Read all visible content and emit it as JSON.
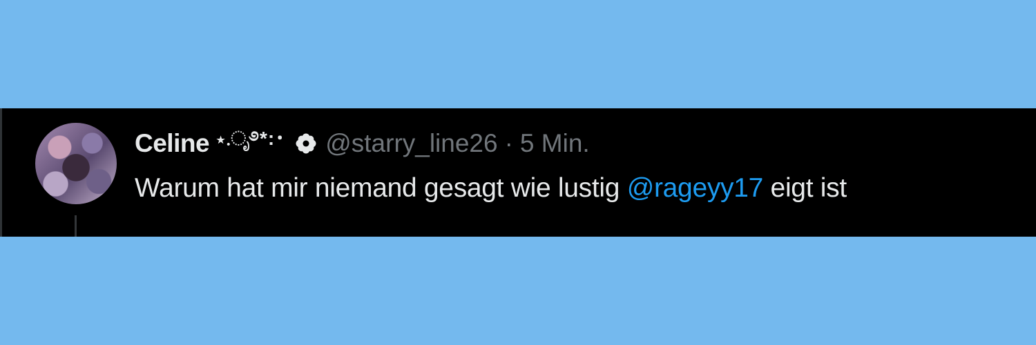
{
  "colors": {
    "page_background": "#74b9ee",
    "tweet_background": "#000000",
    "primary_text": "#e7e9ea",
    "secondary_text": "#71767b",
    "mention_link": "#1d9bf0"
  },
  "tweet": {
    "display_name": "Celine",
    "name_decoration": "⋆.ೃ࿔*:･",
    "badge_icon": "flower-badge-icon",
    "handle": "@starry_line26",
    "separator": "·",
    "timestamp": "5 Min.",
    "text_before_mention": "Warum hat mir niemand gesagt wie lustig ",
    "mention": "@rageyy17",
    "text_after_mention": " eigt ist"
  }
}
